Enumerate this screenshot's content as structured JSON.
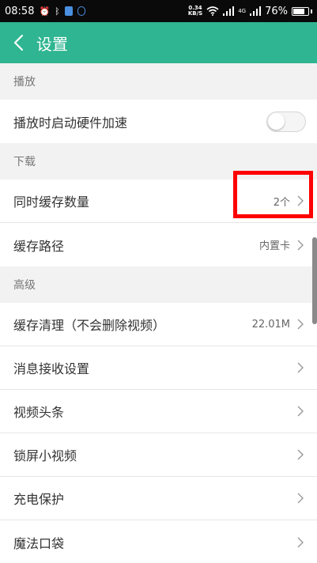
{
  "status_bar": {
    "time": "08:58",
    "net_speed_value": "0.34",
    "net_speed_unit": "KB/S",
    "signal_label": "4G",
    "battery_percent": "76%",
    "battery_level": 0.76
  },
  "app_bar": {
    "title": "设置"
  },
  "sections": {
    "playback": {
      "header": "播放",
      "hw_accel_label": "播放时启动硬件加速",
      "hw_accel_enabled": false
    },
    "download": {
      "header": "下载",
      "concurrent_label": "同时缓存数量",
      "concurrent_value": "2个",
      "path_label": "缓存路径",
      "path_value": "内置卡"
    },
    "advanced": {
      "header": "高级",
      "items": [
        {
          "label": "缓存清理（不会删除视频）",
          "value": "22.01M"
        },
        {
          "label": "消息接收设置",
          "value": ""
        },
        {
          "label": "视频头条",
          "value": ""
        },
        {
          "label": "锁屏小视频",
          "value": ""
        },
        {
          "label": "充电保护",
          "value": ""
        },
        {
          "label": "魔法口袋",
          "value": ""
        }
      ]
    }
  },
  "colors": {
    "app_bar": "#2fb591",
    "status_bar": "#0a0a0a",
    "highlight": "#ff0000"
  }
}
